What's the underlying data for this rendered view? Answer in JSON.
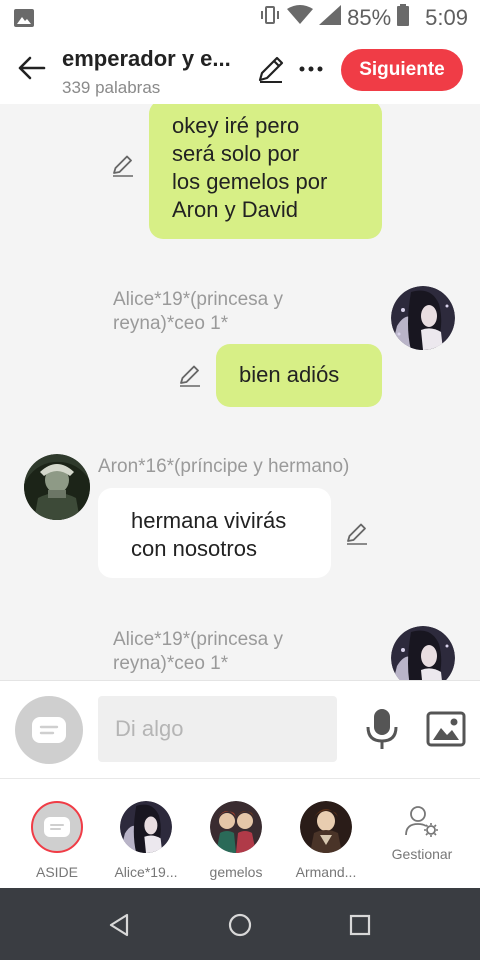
{
  "status_bar": {
    "battery_pct": "85%",
    "time": "5:09"
  },
  "header": {
    "title": "emperador y e...",
    "subtitle": "339 palabras",
    "next_label": "Siguiente"
  },
  "messages": [
    {
      "type": "outgoing",
      "text_lines": [
        "okey iré pero",
        "será solo por",
        "los gemelos por",
        "Aron y David"
      ]
    },
    {
      "type": "outgoing",
      "sender_lines": [
        "Alice*19*(princesa y",
        "reyna)*ceo 1*"
      ],
      "text": "bien adiós"
    },
    {
      "type": "incoming",
      "sender": "Aron*16*(príncipe y hermano)",
      "text_lines": [
        "hermana vivirás",
        "con nosotros"
      ]
    },
    {
      "type": "outgoing",
      "sender_lines": [
        "Alice*19*(princesa y",
        "reyna)*ceo 1*"
      ]
    }
  ],
  "input": {
    "placeholder": "Di algo"
  },
  "tabs": [
    {
      "label": "ASIDE"
    },
    {
      "label": "Alice*19..."
    },
    {
      "label": "gemelos"
    },
    {
      "label": "Armand..."
    },
    {
      "label": "Gestionar"
    }
  ],
  "colors": {
    "accent_red": "#f03c46",
    "bubble_green": "#d7ef86",
    "nav_dark": "#3a3d42"
  }
}
